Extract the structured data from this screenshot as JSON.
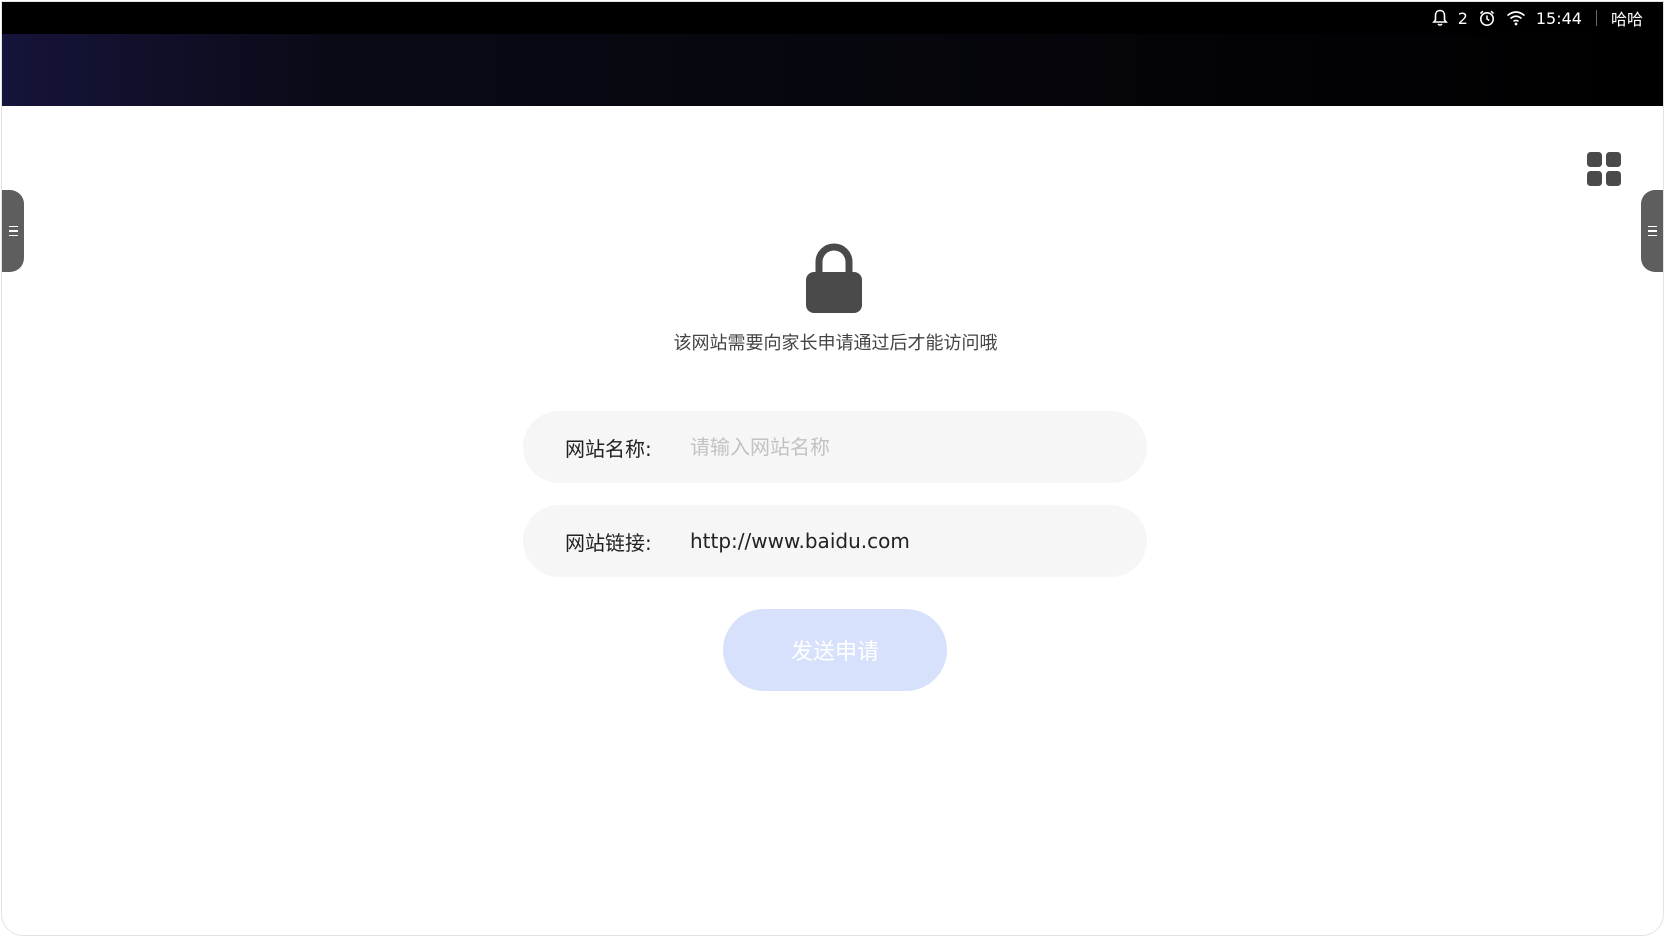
{
  "status_bar": {
    "notification_count": "2",
    "time": "15:44",
    "user": "哈哈",
    "icons": [
      "bell-icon",
      "alarm-icon",
      "wifi-icon"
    ]
  },
  "app": {
    "apps_icon": "grid-icon",
    "lock_icon": "lock-icon",
    "message": "该网站需要向家长申请通过后才能访问哦"
  },
  "form": {
    "name_label": "网站名称:",
    "name_placeholder": "请输入网站名称",
    "name_value": "",
    "link_label": "网站链接:",
    "link_value": "http://www.baidu.com",
    "submit_label": "发送申请"
  },
  "colors": {
    "button_bg": "#d8e1fb",
    "field_bg": "#f6f6f6",
    "icon_dark": "#4a4a4a"
  }
}
